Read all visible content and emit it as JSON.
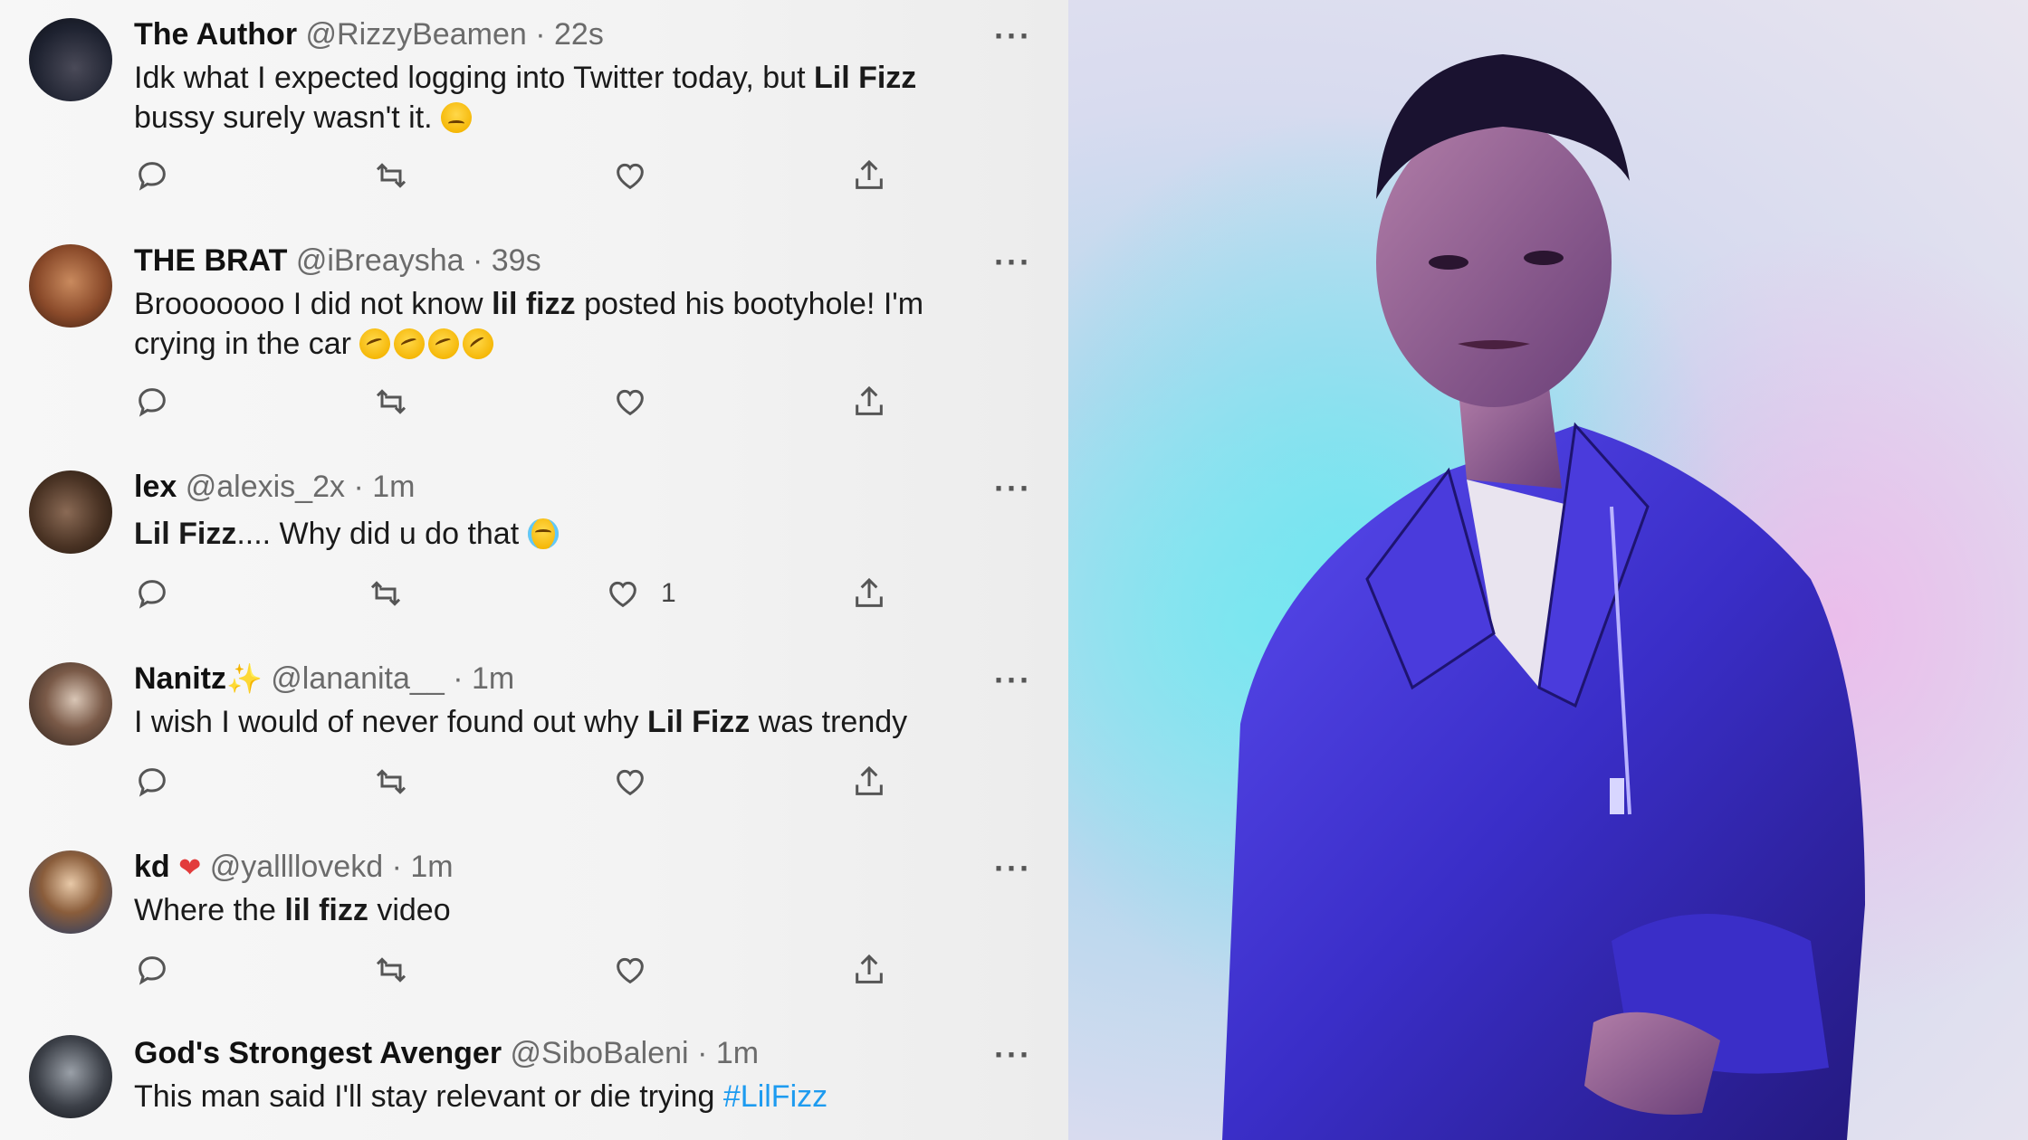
{
  "tweets": [
    {
      "name": "The Author",
      "handle": "@RizzyBeamen",
      "time": "22s",
      "text_parts": [
        "Idk what I expected logging into Twitter today, but ",
        "Lil Fizz",
        " bussy surely wasn't it."
      ],
      "emojis": [
        "sad-face-emoji"
      ],
      "like_count": ""
    },
    {
      "name": "THE BRAT",
      "handle": "@iBreaysha",
      "time": "39s",
      "text_parts": [
        "Brooooooo I did not know ",
        "lil fizz",
        " posted his bootyhole! I'm crying in the car"
      ],
      "emojis": [
        "tears-of-joy-emoji",
        "tears-of-joy-emoji",
        "tears-of-joy-emoji",
        "rolling-laughing-emoji"
      ],
      "like_count": ""
    },
    {
      "name": "lex",
      "handle": "@alexis_2x",
      "time": "1m",
      "text_parts": [
        "Lil Fizz",
        ".... Why did u do that"
      ],
      "emojis": [
        "loudly-crying-emoji"
      ],
      "like_count": "1"
    },
    {
      "name": "Nanitz",
      "handle": "@lananita__",
      "time": "1m",
      "text_parts": [
        "I wish I would of never found out why ",
        "Lil Fizz",
        " was trendy"
      ],
      "emojis": [],
      "like_count": ""
    },
    {
      "name": "kd",
      "handle": "@yallllovekd",
      "time": "1m",
      "text_parts": [
        "Where the ",
        "lil fizz",
        " video"
      ],
      "emojis": [],
      "like_count": ""
    },
    {
      "name": "God's Strongest Avenger",
      "handle": "@SiboBaleni",
      "time": "1m",
      "text_parts": [
        "This man said I'll stay relevant or die trying ",
        "#LilFizz"
      ],
      "emojis": [],
      "like_count": ""
    }
  ],
  "separator": "·",
  "more_label": "···",
  "colors": {
    "link": "#1d9bf0",
    "text": "#1a1a1a",
    "muted": "#6b6b6b",
    "jacket": "#3b2fc9"
  },
  "icons": [
    "reply-icon",
    "retweet-icon",
    "like-icon",
    "share-icon",
    "more-icon"
  ]
}
